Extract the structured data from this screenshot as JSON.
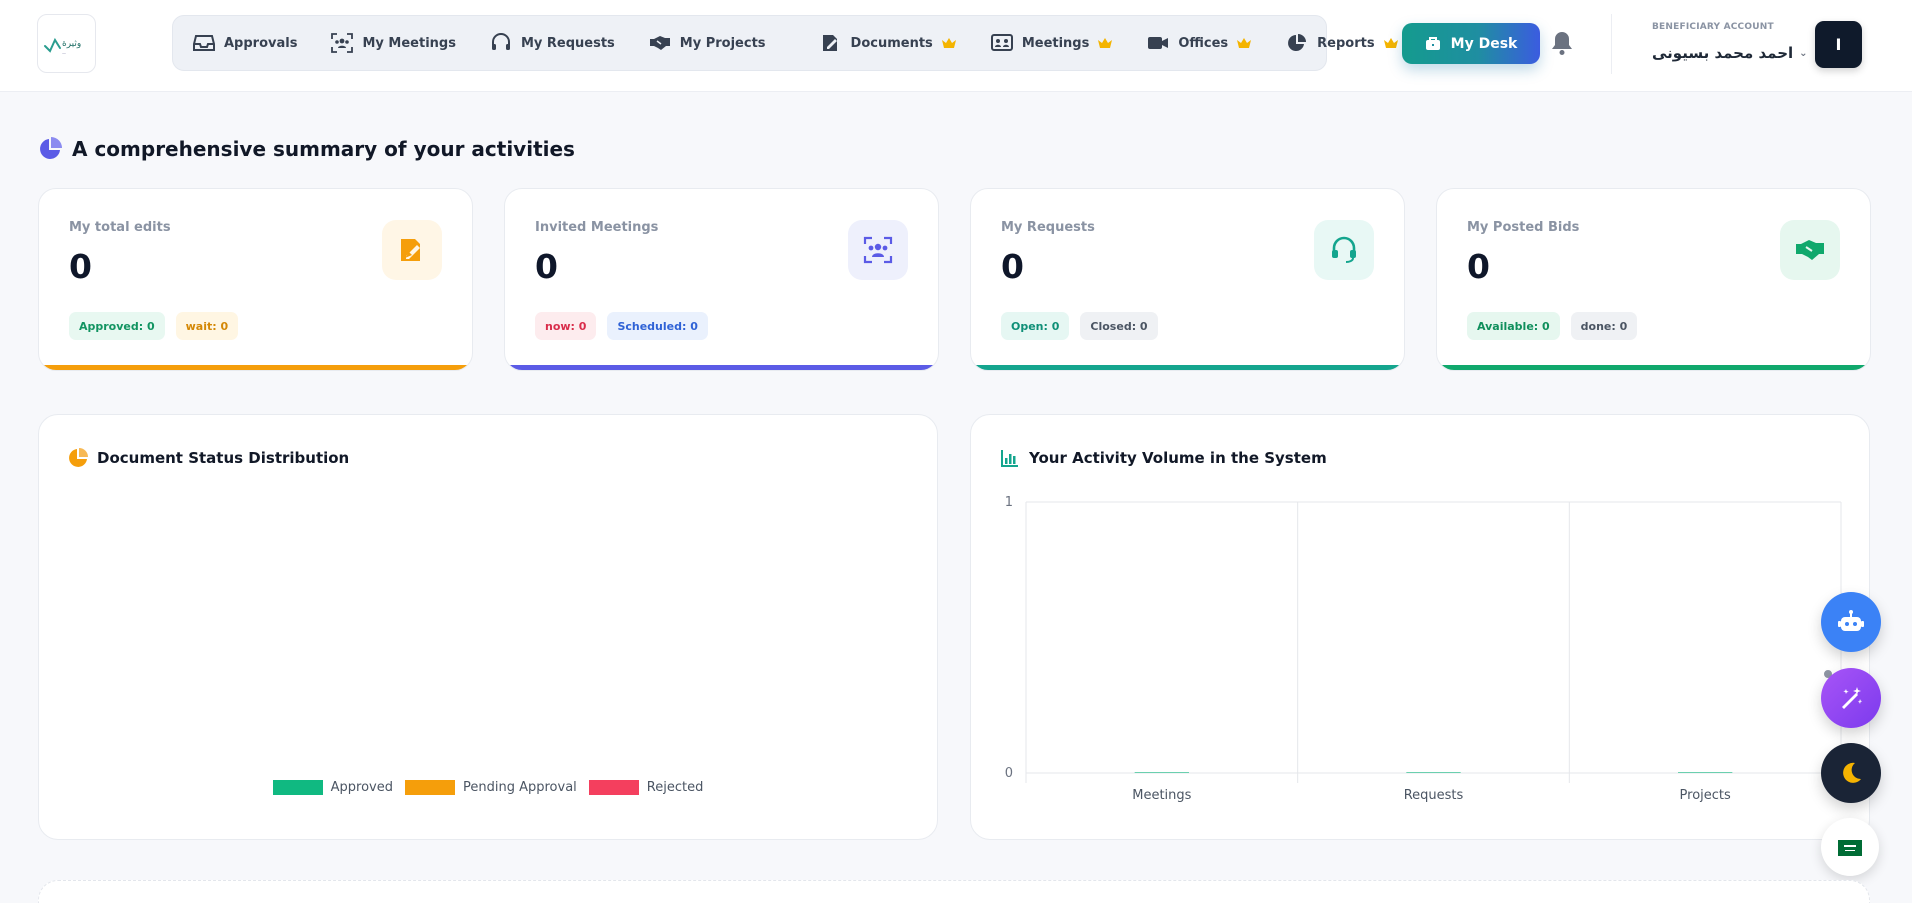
{
  "header": {
    "logo_text": "وثيرة",
    "nav": [
      {
        "label": "Approvals",
        "icon": "inbox-icon",
        "premium": false
      },
      {
        "label": "My Meetings",
        "icon": "users-meeting-icon",
        "premium": false
      },
      {
        "label": "My Requests",
        "icon": "headset-icon",
        "premium": false
      },
      {
        "label": "My Projects",
        "icon": "handshake-icon",
        "premium": false
      },
      {
        "label": "Documents",
        "icon": "document-edit-icon",
        "premium": true
      },
      {
        "label": "Meetings",
        "icon": "meeting-board-icon",
        "premium": true
      },
      {
        "label": "Offices",
        "icon": "video-camera-icon",
        "premium": true
      },
      {
        "label": "Reports",
        "icon": "pie-chart-icon",
        "premium": true
      }
    ],
    "my_desk_label": "My Desk",
    "account_label": "BENEFICIARY ACCOUNT",
    "account_name": "احمد محمد بسيونى",
    "avatar_initial": "I"
  },
  "summary": {
    "title": "A comprehensive summary of your activities"
  },
  "cards": [
    {
      "title": "My total edits",
      "count": "0",
      "pills": [
        "Approved: 0",
        "wait: 0"
      ],
      "accent": "#f59e0b"
    },
    {
      "title": "Invited Meetings",
      "count": "0",
      "pills": [
        "now: 0",
        "Scheduled: 0"
      ],
      "accent": "#5b5be6"
    },
    {
      "title": "My Requests",
      "count": "0",
      "pills": [
        "Open: 0",
        "Closed: 0"
      ],
      "accent": "#14a58e"
    },
    {
      "title": "My Posted Bids",
      "count": "0",
      "pills": [
        "Available: 0",
        "done: 0"
      ],
      "accent": "#10a86c"
    }
  ],
  "doc_status": {
    "title": "Document Status Distribution",
    "legend": [
      {
        "label": "Approved",
        "color": "#10b981"
      },
      {
        "label": "Pending Approval",
        "color": "#f59e0b"
      },
      {
        "label": "Rejected",
        "color": "#f43f5e"
      }
    ]
  },
  "activity": {
    "title": "Your Activity Volume in the System"
  },
  "chart_data": {
    "type": "bar",
    "title": "Your Activity Volume in the System",
    "categories": [
      "Meetings",
      "Requests",
      "Projects"
    ],
    "values": [
      0,
      0,
      0
    ],
    "ylim": [
      0,
      1
    ],
    "yticks": [
      "1",
      "0"
    ],
    "grid": true,
    "bar_color": "#10b981"
  },
  "floating": [
    "robot-icon",
    "magic-wand-icon",
    "moon-icon",
    "saudi-flag-icon"
  ],
  "colors": {
    "accent": "#1f8ea1",
    "brand_gradient_end": "#3b5ce0"
  }
}
